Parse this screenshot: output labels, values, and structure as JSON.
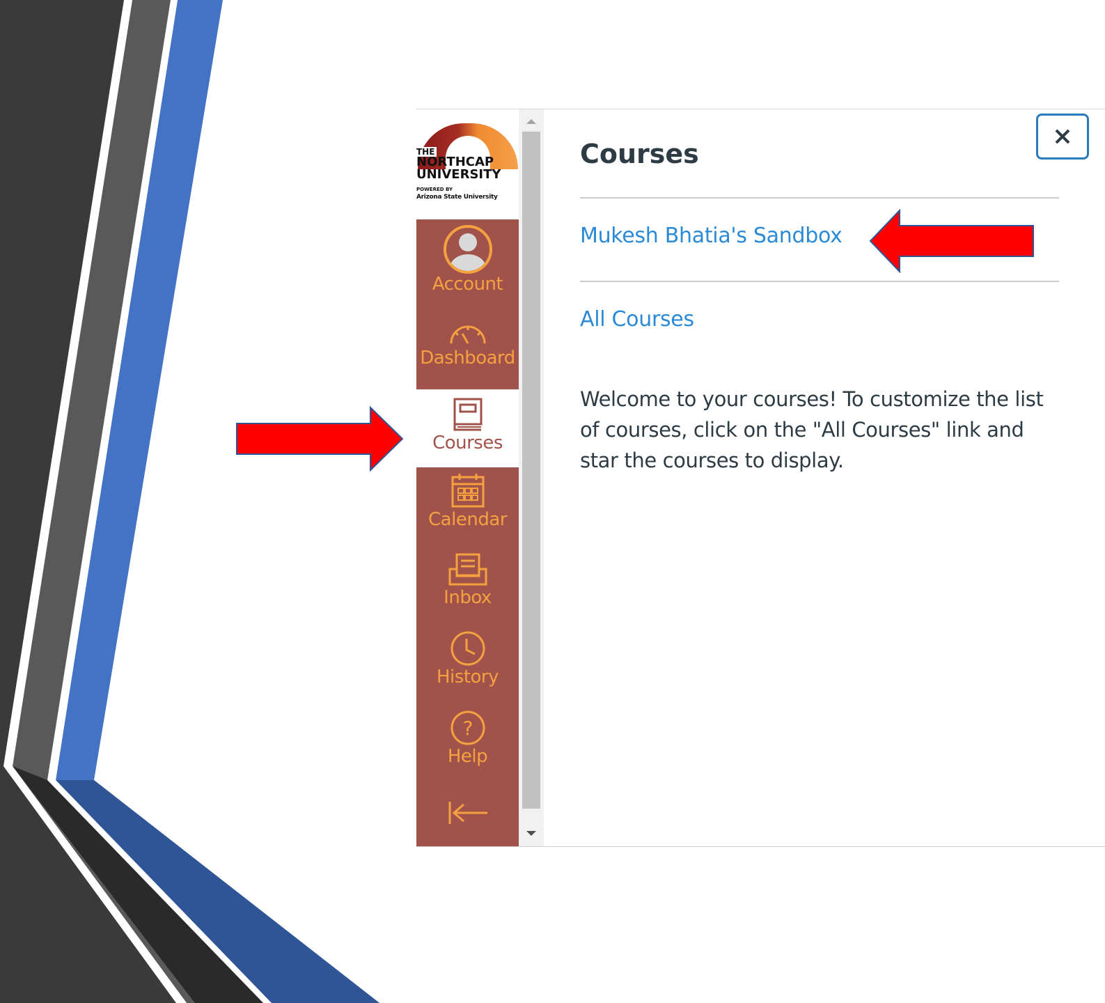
{
  "nav": {
    "logo": {
      "line1": "THE",
      "line2": "NORTHCAP",
      "line3": "UNIVERSITY",
      "line4": "POWERED BY",
      "line5": "Arizona State University"
    },
    "items": [
      {
        "label": "Account",
        "icon": "user-avatar-icon",
        "active": false
      },
      {
        "label": "Dashboard",
        "icon": "speedometer-icon",
        "active": false
      },
      {
        "label": "Courses",
        "icon": "book-icon",
        "active": true
      },
      {
        "label": "Calendar",
        "icon": "calendar-icon",
        "active": false
      },
      {
        "label": "Inbox",
        "icon": "inbox-icon",
        "active": false
      },
      {
        "label": "History",
        "icon": "clock-icon",
        "active": false
      },
      {
        "label": "Help",
        "icon": "question-icon",
        "active": false
      }
    ],
    "collapse_icon": "collapse-arrow-icon"
  },
  "tray": {
    "title": "Courses",
    "close_icon": "close-icon",
    "course_link": "Mukesh Bhatia's Sandbox",
    "all_courses_link": "All Courses",
    "description": "Welcome to your courses! To customize the list of courses, click on the \"All Courses\" link and star the courses to display."
  },
  "colors": {
    "nav_bg": "#a1524b",
    "nav_text": "#f5a140",
    "link": "#2b8ad6",
    "close_border": "#2b7abc",
    "annotation_arrow": "#ff0000",
    "deco_dark": "#3a3a3a",
    "deco_grey": "#5a5a5a",
    "deco_blue": "#4472c4"
  }
}
